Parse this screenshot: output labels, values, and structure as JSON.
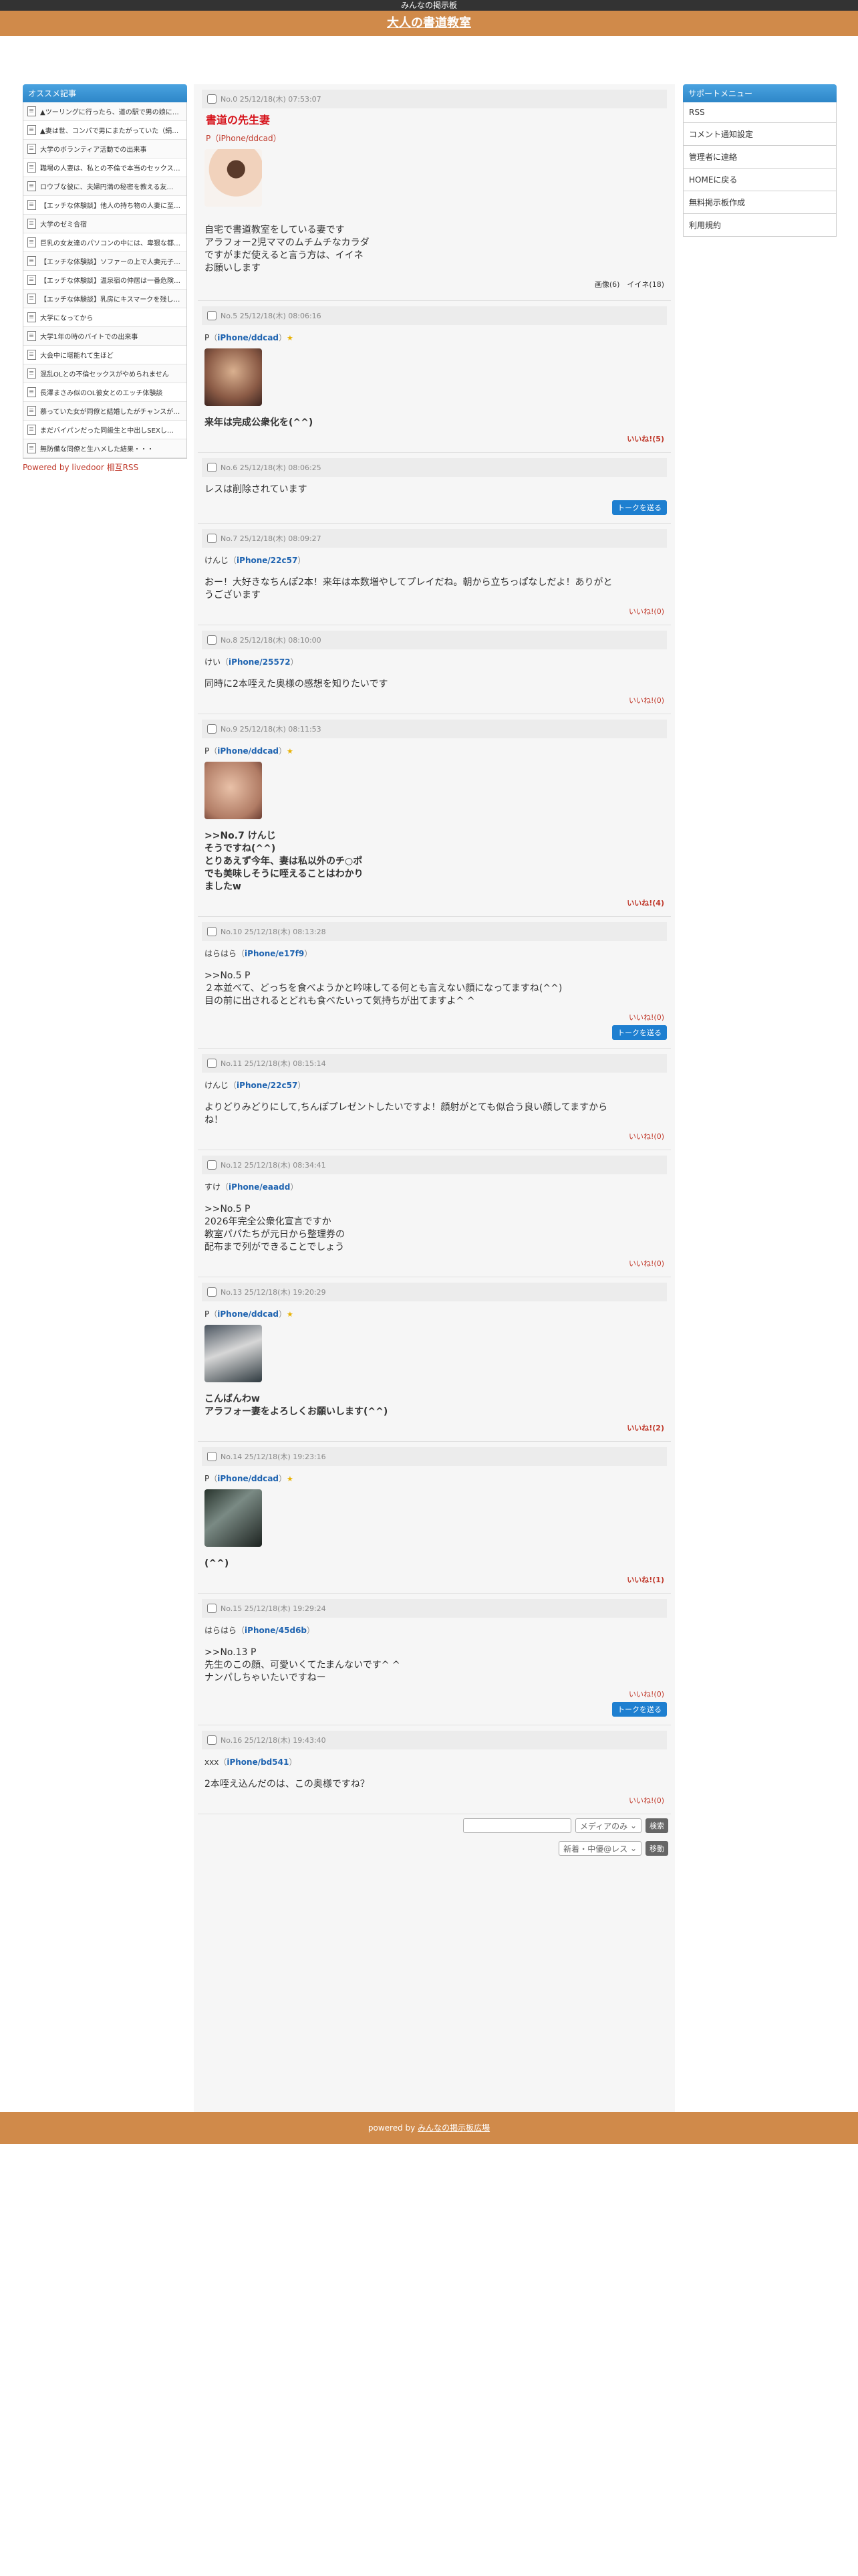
{
  "site": {
    "top_label": "みんなの掲示板",
    "title": "大人の書道教室",
    "footer_text": "powered by ",
    "footer_link": "みんなの掲示板広場"
  },
  "left": {
    "title": "オススメ記事",
    "items": [
      "▲ツーリングに行ったら、道の駅で男の娘に…",
      "▲妻は世、コンパで男にまたがっていた（絹…",
      "大学のボランティア活動での出来事",
      "職場の人妻は、私との不倫で本当のセックス…",
      "ロウブな彼に、夫婦円満の秘密を教える友…",
      "【エッチな体験談】他人の持ち物の人妻に至…",
      "大学のゼミ合宿",
      "巨乳の女友達のパソコンの中には、卑猥な都…",
      "【エッチな体験談】ソファーの上で人妻元子…",
      "【エッチな体験談】温泉宿の仲居は一番危険日…",
      "【エッチな体験談】乳房にキスマークを残し…",
      "大学になってから",
      "大学1年の時のバイトでの出来事",
      "大会中に堪能れて生ほど",
      "混乱OLとの不倫セックスがやめられません",
      "長澤まさみ似のOL彼女とのエッチ体験談",
      "慕っていた女が同僚と結婚したがチャンスが…",
      "まだバイパンだった同級生と中出しSEXし…",
      "無防備な同僚と生ハメした結果・・・"
    ],
    "powered": "Powered by livedoor 相互RSS"
  },
  "right": {
    "title": "サポートメニュー",
    "items": [
      "RSS",
      "コメント通知設定",
      "管理者に連絡",
      "HOMEに戻る",
      "無料掲示板作成",
      "利用規約"
    ]
  },
  "op": {
    "no": "No.0 25/12/18(木) 07:53:07",
    "title": "書道の先生妻",
    "user": "P（iPhone/ddcad）",
    "body": [
      "自宅で書道教室をしている妻です",
      "アラフォー2児ママのムチムチなカラダ",
      "ですがまだ使えると言う方は、イイネ",
      "お願いします"
    ],
    "stats": "画像(6)　イイネ(18)"
  },
  "posts": [
    {
      "no": "No.5  25/12/18(木) 08:06:16",
      "name": "P",
      "dev": "iPhone/ddcad",
      "star": true,
      "thumb": "g-dark",
      "body": [
        "来年は完成公衆化を(^^)"
      ],
      "bold": true,
      "iine": "いいね!(5)",
      "iine_bold": true,
      "to": false
    },
    {
      "no": "No.6  25/12/18(木) 08:06:25",
      "name": "",
      "dev": "",
      "star": false,
      "thumb": "",
      "body": [
        "レスは削除されています"
      ],
      "bold": false,
      "iine": "",
      "iine_bold": false,
      "to": true
    },
    {
      "no": "No.7  25/12/18(木) 08:09:27",
      "name": "けんじ",
      "dev": "iPhone/22c57",
      "star": false,
      "thumb": "",
      "body": [
        "おー！大好きなちんぽ2本！来年は本数増やしてプレイだね。朝から立ちっぱなしだよ！ありがと",
        "うございます"
      ],
      "bold": false,
      "iine": "いいね!(0)",
      "iine_bold": false,
      "to": false
    },
    {
      "no": "No.8  25/12/18(木) 08:10:00",
      "name": "けい",
      "dev": "iPhone/25572",
      "star": false,
      "thumb": "",
      "body": [
        "同時に2本咥えた奥様の感想を知りたいです"
      ],
      "bold": false,
      "iine": "いいね!(0)",
      "iine_bold": false,
      "to": false
    },
    {
      "no": "No.9  25/12/18(木) 08:11:53",
      "name": "P",
      "dev": "iPhone/ddcad",
      "star": true,
      "thumb": "g-skin",
      "body": [
        ">>No.7 けんじ",
        "そうですね(^^)",
        "とりあえず今年、妻は私以外のチ○ポ",
        "でも美味しそうに咥えることはわかり",
        "ましたw"
      ],
      "bold": true,
      "iine": "いいね!(4)",
      "iine_bold": true,
      "to": false
    },
    {
      "no": "No.10  25/12/18(木) 08:13:28",
      "name": "はらはら",
      "dev": "iPhone/e17f9",
      "star": false,
      "thumb": "",
      "body": [
        ">>No.5 P",
        "２本並べて、どっちを食べようかと吟味してる何とも言えない顔になってますね(^^)",
        "目の前に出されるとどれも食べたいって気持ちが出てますよ^ ^"
      ],
      "bold": false,
      "iine": "いいね!(0)",
      "iine_bold": false,
      "to": true
    },
    {
      "no": "No.11  25/12/18(木) 08:15:14",
      "name": "けんじ",
      "dev": "iPhone/22c57",
      "star": false,
      "thumb": "",
      "body": [
        "よりどりみどりにして,ちんぽプレゼントしたいですよ！顔射がとても似合う良い顔してますから",
        "ね！"
      ],
      "bold": false,
      "iine": "いいね!(0)",
      "iine_bold": false,
      "to": false
    },
    {
      "no": "No.12  25/12/18(木) 08:34:41",
      "name": "すけ",
      "dev": "iPhone/eaadd",
      "star": false,
      "thumb": "",
      "body": [
        ">>No.5 P",
        "2026年完全公衆化宣言ですか",
        "教室パパたちが元日から整理券の",
        "配布まで列ができることでしょう"
      ],
      "bold": false,
      "iine": "いいね!(0)",
      "iine_bold": false,
      "to": false
    },
    {
      "no": "No.13  25/12/18(木) 19:20:29",
      "name": "P",
      "dev": "iPhone/ddcad",
      "star": true,
      "thumb": "g-photo1",
      "body": [
        "こんばんわw",
        "アラフォー妻をよろしくお願いします(^^)"
      ],
      "bold": true,
      "iine": "いいね!(2)",
      "iine_bold": true,
      "to": false
    },
    {
      "no": "No.14  25/12/18(木) 19:23:16",
      "name": "P",
      "dev": "iPhone/ddcad",
      "star": true,
      "thumb": "g-photo2",
      "body": [
        "(^^)"
      ],
      "bold": true,
      "iine": "いいね!(1)",
      "iine_bold": true,
      "to": false
    },
    {
      "no": "No.15  25/12/18(木) 19:29:24",
      "name": "はらはら",
      "dev": "iPhone/45d6b",
      "star": false,
      "thumb": "",
      "body": [
        ">>No.13 P",
        "先生のこの顔、可愛いくてたまんないです^ ^",
        "ナンパしちゃいたいですねー"
      ],
      "bold": false,
      "iine": "いいね!(0)",
      "iine_bold": false,
      "to": true
    },
    {
      "no": "No.16  25/12/18(木) 19:43:40",
      "name": "xxx",
      "dev": "iPhone/bd541",
      "star": false,
      "thumb": "",
      "body": [
        "2本咥え込んだのは、この奥様ですね？"
      ],
      "bold": false,
      "iine": "いいね!(0)",
      "iine_bold": false,
      "to": false
    }
  ],
  "controls": {
    "media_select": "メディアのみ",
    "search_button": "検索",
    "order_select": "新着・中優@レス",
    "go_button": "移動",
    "to_button": "トークを送る"
  }
}
